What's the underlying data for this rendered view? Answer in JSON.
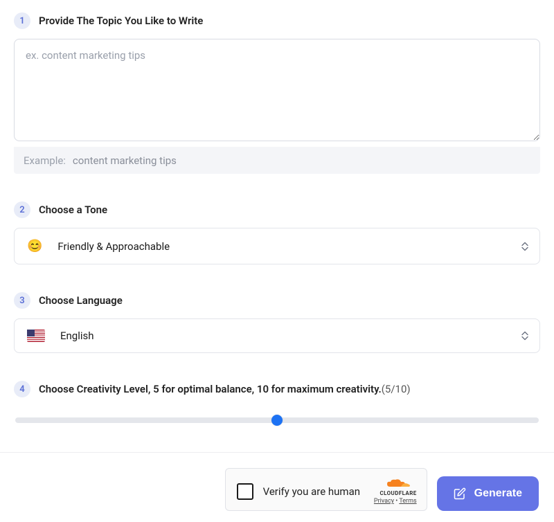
{
  "steps": {
    "topic": {
      "number": "1",
      "label": "Provide The Topic You Like to Write",
      "placeholder": "ex. content marketing tips",
      "value": "",
      "exampleLabel": "Example:",
      "exampleValue": "content marketing tips"
    },
    "tone": {
      "number": "2",
      "label": "Choose a Tone",
      "emoji": "😊",
      "selected": "Friendly & Approachable"
    },
    "language": {
      "number": "3",
      "label": "Choose Language",
      "selected": "English"
    },
    "creativity": {
      "number": "4",
      "label": "Choose Creativity Level, 5 for optimal balance, 10 for maximum creativity.",
      "displayValue": "(5/10)",
      "min": 0,
      "max": 10,
      "value": 5
    }
  },
  "captcha": {
    "text": "Verify you are human",
    "brand": "CLOUDFLARE",
    "privacy": "Privacy",
    "terms": "Terms"
  },
  "buttons": {
    "generate": "Generate"
  }
}
